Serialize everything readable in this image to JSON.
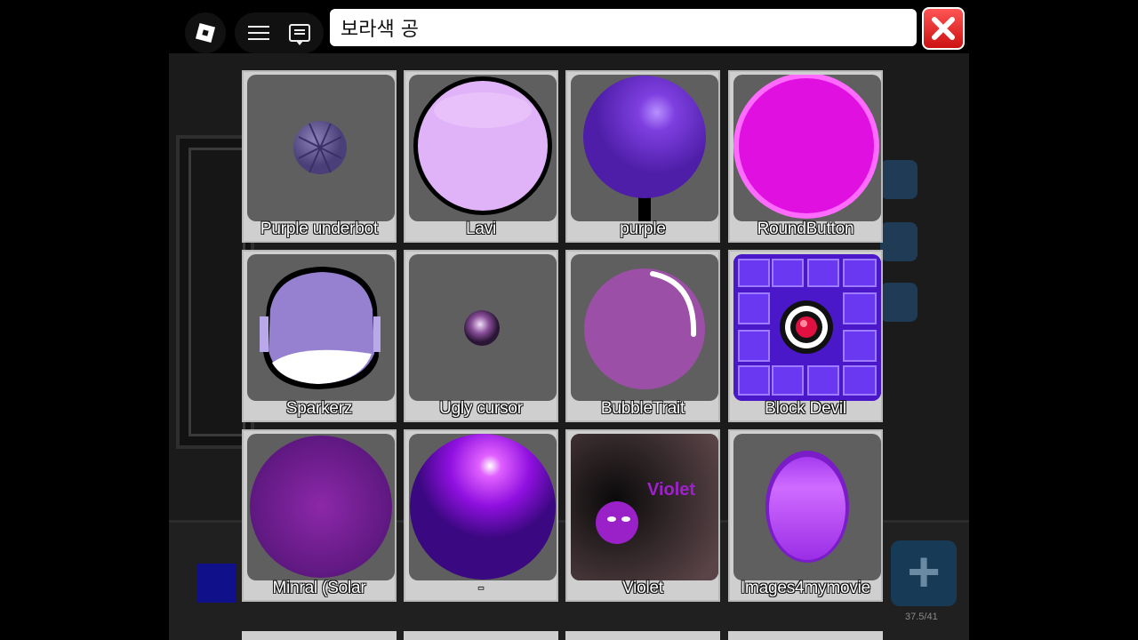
{
  "search": {
    "value": "보라색 공"
  },
  "hud": {
    "count": "37.5/41",
    "plus": "+"
  },
  "items": [
    {
      "label": "Purple underbot"
    },
    {
      "label": "Lavi"
    },
    {
      "label": "purple"
    },
    {
      "label": "RoundButton"
    },
    {
      "label": "Sparkerz"
    },
    {
      "label": "Ugly cursor"
    },
    {
      "label": "BubbleTrait"
    },
    {
      "label": "Block Devil"
    },
    {
      "label": "Minral (Solar"
    },
    {
      "label": "-"
    },
    {
      "label": "Violet",
      "thumb_text": "Violet"
    },
    {
      "label": "Images4mymovie"
    }
  ],
  "colors": {
    "close": "#e33333",
    "tile_bg": "#5f5f5f",
    "tile_border": "#cfcfcf"
  }
}
